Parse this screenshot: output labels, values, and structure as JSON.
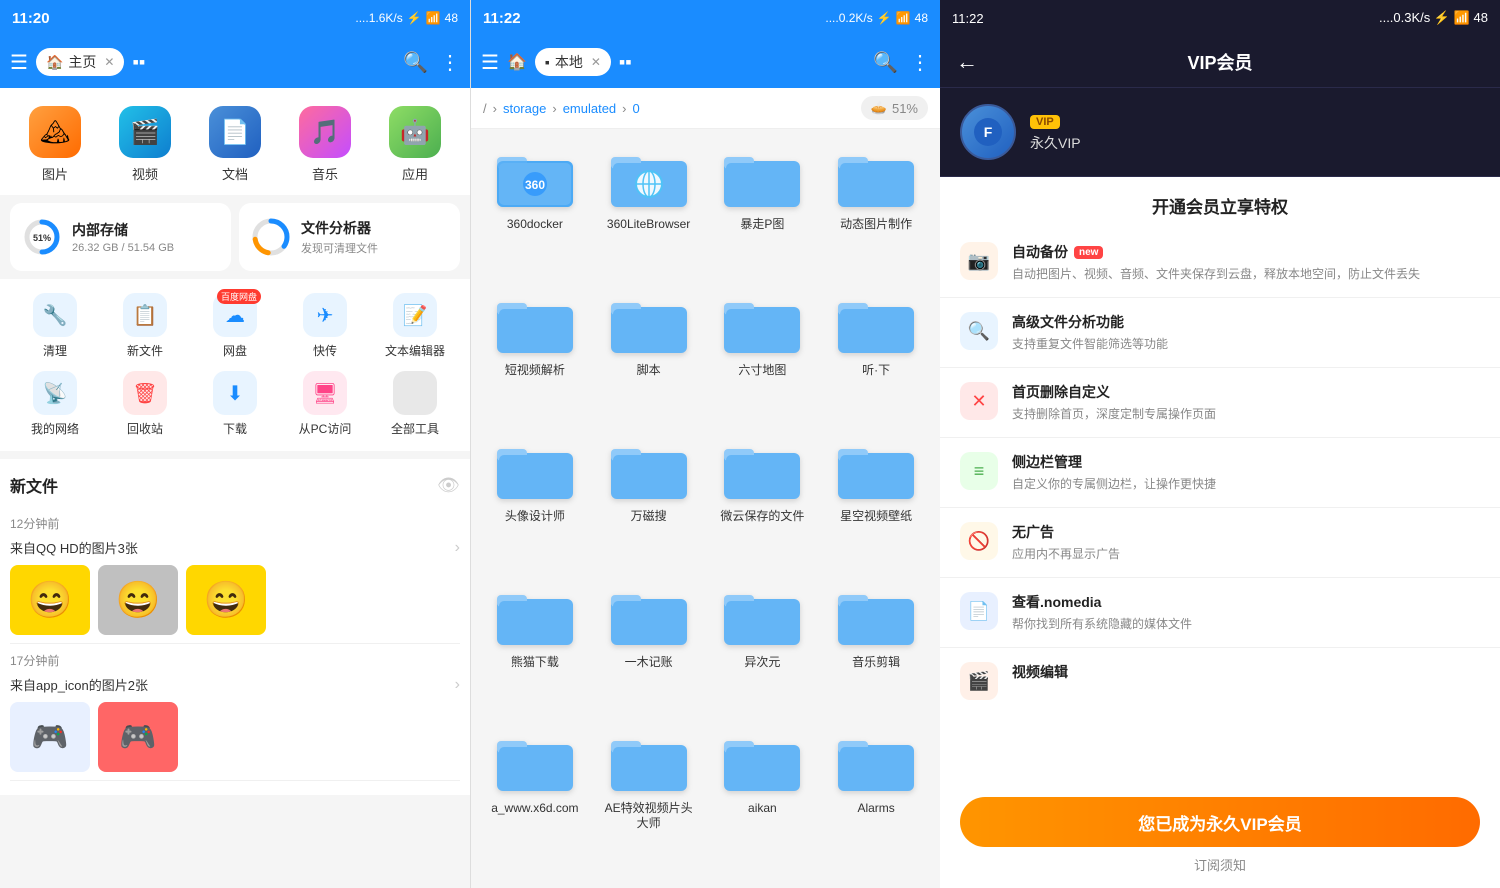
{
  "panel1": {
    "status_time": "11:20",
    "status_icons": "....1.6K/s ♦ ✗ ▲ ≈ 48",
    "nav_tab_label": "主页",
    "categories": [
      {
        "id": "img",
        "label": "图片",
        "icon": "🏔",
        "color_class": "img"
      },
      {
        "id": "video",
        "label": "视频",
        "icon": "🎬",
        "color_class": "video"
      },
      {
        "id": "doc",
        "label": "文档",
        "icon": "📄",
        "color_class": "doc"
      },
      {
        "id": "music",
        "label": "音乐",
        "icon": "🎵",
        "color_class": "music"
      },
      {
        "id": "app",
        "label": "应用",
        "icon": "🤖",
        "color_class": "app"
      }
    ],
    "storage": {
      "internal_label": "内部存储",
      "internal_used": "51%",
      "internal_detail": "26.32 GB / 51.54 GB",
      "analyzer_label": "文件分析器",
      "analyzer_sub": "发现可清理文件"
    },
    "tools": [
      {
        "label": "清理",
        "icon": "🔧",
        "class": "clean"
      },
      {
        "label": "新文件",
        "icon": "📋",
        "class": "newfile"
      },
      {
        "label": "网盘",
        "icon": "☁",
        "class": "cloud",
        "badge": "百度网盘"
      },
      {
        "label": "快传",
        "icon": "✈",
        "class": "transfer"
      },
      {
        "label": "文本编辑器",
        "icon": "📝",
        "class": "editor"
      },
      {
        "label": "我的网络",
        "icon": "📡",
        "class": "network"
      },
      {
        "label": "回收站",
        "icon": "🗑",
        "class": "trash"
      },
      {
        "label": "下载",
        "icon": "⬇",
        "class": "download"
      },
      {
        "label": "从PC访问",
        "icon": "🖥",
        "class": "pc"
      },
      {
        "label": "全部工具",
        "icon": "⚙",
        "class": "alltools"
      }
    ],
    "new_files_title": "新文件",
    "file_entries": [
      {
        "time": "12分钟前",
        "source": "来自QQ HD的图片3张",
        "thumbs": [
          "😄",
          "😄",
          "😄"
        ]
      },
      {
        "time": "17分钟前",
        "source": "来自app_icon的图片2张",
        "thumbs": [
          "🎮",
          "🎮"
        ]
      }
    ]
  },
  "panel2": {
    "status_time": "11:22",
    "status_icons": "....0.2K/s ♦ ✗ ▲ ≈ 48",
    "nav_tab_label": "本地",
    "breadcrumbs": [
      "/",
      "storage",
      "emulated",
      "0"
    ],
    "storage_percent": "51%",
    "folders": [
      {
        "name": "360docker"
      },
      {
        "name": "360LiteBrowser"
      },
      {
        "name": "暴走P图"
      },
      {
        "name": "动态图片制作"
      },
      {
        "name": "短视频解析"
      },
      {
        "name": "脚本"
      },
      {
        "name": "六寸地图"
      },
      {
        "name": "听·下"
      },
      {
        "name": "头像设计师"
      },
      {
        "name": "万磁搜"
      },
      {
        "name": "微云保存的文件"
      },
      {
        "name": "星空视频壁纸"
      },
      {
        "name": "熊猫下载"
      },
      {
        "name": "一木记账"
      },
      {
        "name": "异次元"
      },
      {
        "name": "音乐剪辑"
      },
      {
        "name": "a_www.x6d.com"
      },
      {
        "name": "AE特效视频片头大师"
      },
      {
        "name": "aikan"
      },
      {
        "name": "Alarms"
      }
    ]
  },
  "panel3": {
    "status_time": "11:22",
    "status_icons": "....0.3K/s ♦ ✗ ▲ ≈ 48",
    "title": "VIP会员",
    "avatar_emoji": "🔷",
    "vip_badge": "VIP",
    "vip_label": "永久VIP",
    "section_title": "开通会员立享特权",
    "features": [
      {
        "id": "backup",
        "icon": "📷",
        "class": "backup",
        "title": "自动备份",
        "is_new": true,
        "desc": "自动把图片、视频、音频、文件夹保存到云盘，释放本地空间，防止文件丢失"
      },
      {
        "id": "analyze",
        "icon": "🔍",
        "class": "analyze",
        "title": "高级文件分析功能",
        "is_new": false,
        "desc": "支持重复文件智能筛选等功能"
      },
      {
        "id": "home-del",
        "icon": "✕",
        "class": "home",
        "title": "首页删除自定义",
        "is_new": false,
        "desc": "支持删除首页，深度定制专属操作页面"
      },
      {
        "id": "sidebar",
        "icon": "≡",
        "class": "sidebar",
        "title": "侧边栏管理",
        "is_new": false,
        "desc": "自定义你的专属侧边栏，让操作更快捷"
      },
      {
        "id": "noad",
        "icon": "🚫",
        "class": "noad",
        "title": "无广告",
        "is_new": false,
        "desc": "应用内不再显示广告"
      },
      {
        "id": "nomedia",
        "icon": "📄",
        "class": "nomedia",
        "title": "查看.nomedia",
        "is_new": false,
        "desc": "帮你找到所有系统隐藏的媒体文件"
      },
      {
        "id": "video-edit",
        "icon": "🎬",
        "class": "video-edit",
        "title": "视频编辑",
        "is_new": false,
        "desc": ""
      }
    ],
    "vip_button_label": "您已成为永久VIP会员",
    "sub_link": "订阅须知",
    "new_label": "new"
  }
}
